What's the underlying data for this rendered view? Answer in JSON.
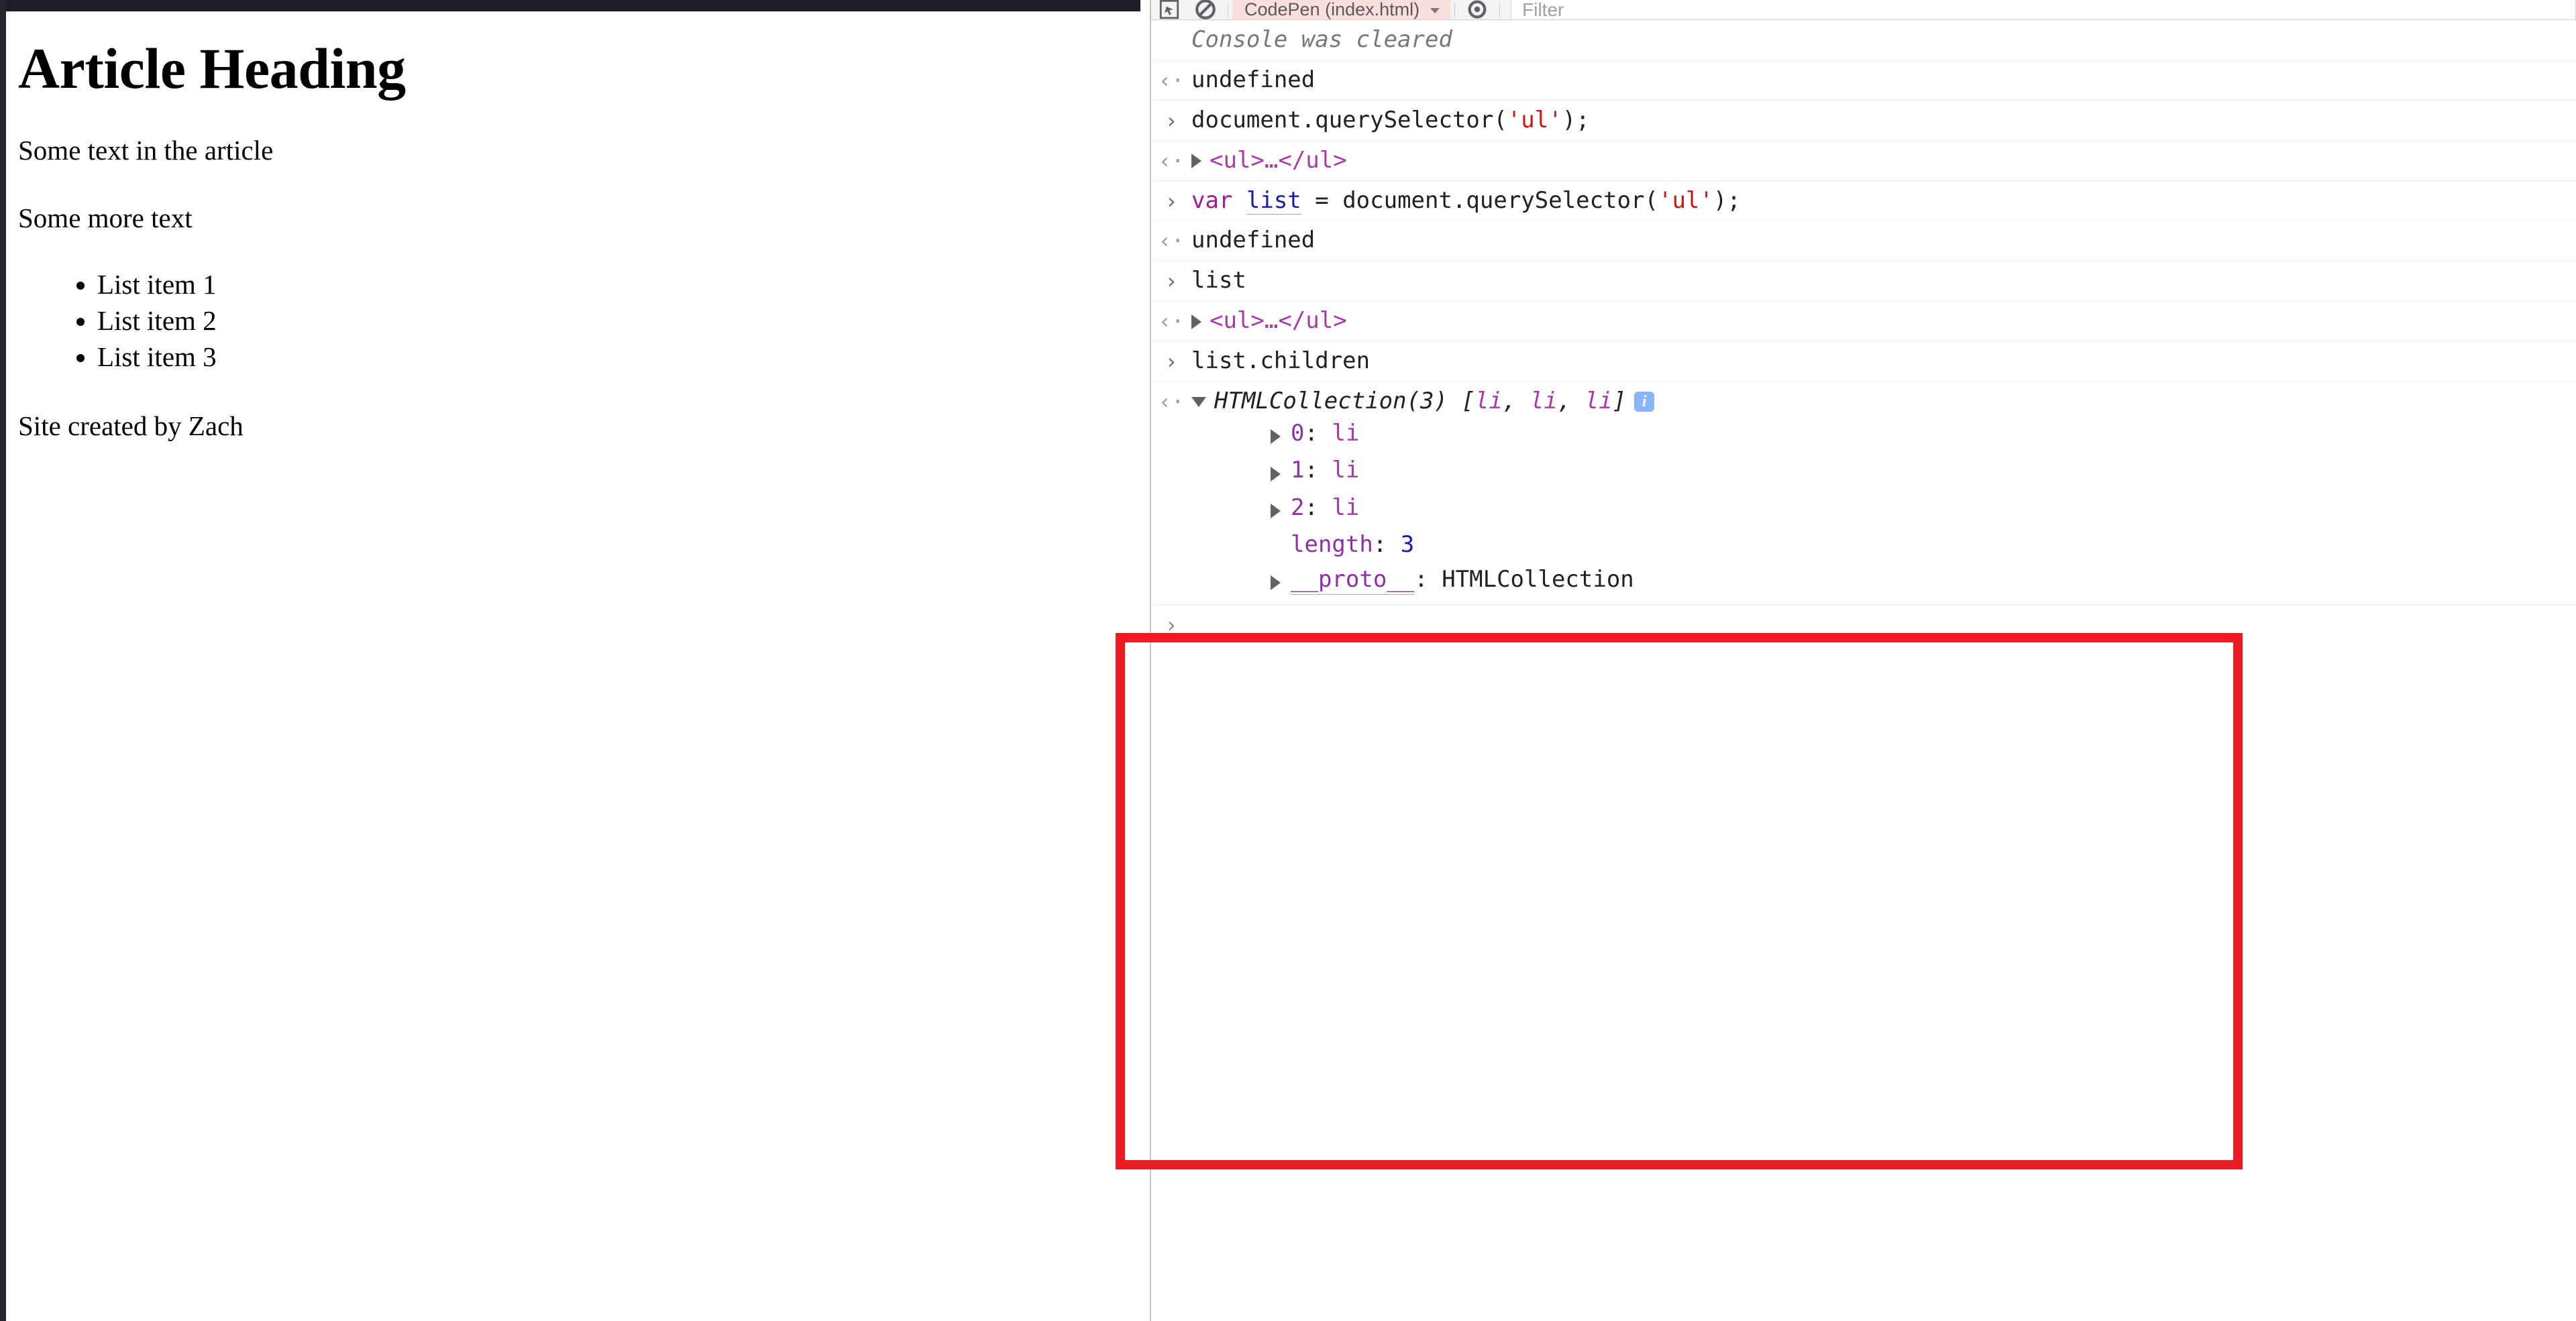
{
  "browser": {
    "chrome_bar_color": "#1d1d28"
  },
  "page": {
    "heading": "Article Heading",
    "paragraph_1": "Some text in the article",
    "paragraph_2": "Some more text",
    "list_items": [
      "List item 1",
      "List item 2",
      "List item 3"
    ],
    "footer": "Site created by Zach"
  },
  "devtools": {
    "toolbar": {
      "inspect_icon": "inspect-element-icon",
      "device_icon": "device-toolbar-icon",
      "clear_icon": "clear-console-icon",
      "context_label": "CodePen (index.html)",
      "context_caret": "chevron-down-icon",
      "filter_placeholder": "Filter"
    },
    "accent_colors": {
      "string": "#c41a16",
      "keyword": "#a21c8f",
      "variable": "#1a1aa6",
      "node": "#a63aa6",
      "property": "#8d31a6",
      "number": "#1a1aa6",
      "info_badge": "#8ab4f8",
      "annotation_box": "#ee1b22",
      "context_highlight": "#fbdede"
    },
    "messages": [
      {
        "kind": "system",
        "gutter": "",
        "text": "Console was cleared"
      },
      {
        "kind": "output",
        "gutter": "‹·",
        "text": "undefined"
      },
      {
        "kind": "input",
        "gutter": "›",
        "segments": [
          {
            "t": "document.querySelector(",
            "c": "plain"
          },
          {
            "t": "'ul'",
            "c": "str"
          },
          {
            "t": ");",
            "c": "plain"
          }
        ]
      },
      {
        "kind": "output",
        "gutter": "‹·",
        "triangle": "tri-right",
        "segments": [
          {
            "t": "<ul>…</ul>",
            "c": "node"
          }
        ]
      },
      {
        "kind": "input",
        "gutter": "›",
        "segments": [
          {
            "t": "var ",
            "c": "kw"
          },
          {
            "t": "list",
            "c": "var"
          },
          {
            "t": " = document.querySelector(",
            "c": "plain"
          },
          {
            "t": "'ul'",
            "c": "str"
          },
          {
            "t": ");",
            "c": "plain"
          }
        ]
      },
      {
        "kind": "output",
        "gutter": "‹·",
        "text": "undefined"
      },
      {
        "kind": "input",
        "gutter": "›",
        "segments": [
          {
            "t": "list",
            "c": "plain"
          }
        ]
      },
      {
        "kind": "output",
        "gutter": "‹·",
        "triangle": "tri-right",
        "segments": [
          {
            "t": "<ul>…</ul>",
            "c": "node"
          }
        ]
      },
      {
        "kind": "input",
        "gutter": "›",
        "segments": [
          {
            "t": "list.children",
            "c": "plain"
          }
        ]
      },
      {
        "kind": "output-expanded",
        "gutter": "‹·",
        "triangle": "tri-down",
        "segments": [
          {
            "t": "HTMLCollection(3) ",
            "c": "type"
          },
          {
            "t": "[",
            "c": "type"
          },
          {
            "t": "li",
            "c": "li"
          },
          {
            "t": ", ",
            "c": "type"
          },
          {
            "t": "li",
            "c": "li"
          },
          {
            "t": ", ",
            "c": "type"
          },
          {
            "t": "li",
            "c": "li"
          },
          {
            "t": "]",
            "c": "type"
          }
        ],
        "info_badge": "i",
        "children": [
          {
            "triangle": "tri-right",
            "key": "0",
            "sep": ": ",
            "value": "li",
            "key_class": "prop",
            "value_class": "node"
          },
          {
            "triangle": "tri-right",
            "key": "1",
            "sep": ": ",
            "value": "li",
            "key_class": "prop",
            "value_class": "node"
          },
          {
            "triangle": "tri-right",
            "key": "2",
            "sep": ": ",
            "value": "li",
            "key_class": "prop",
            "value_class": "node"
          },
          {
            "triangle": "",
            "key": "length",
            "sep": ": ",
            "value": "3",
            "key_class": "prop",
            "value_class": "num"
          },
          {
            "triangle": "tri-right",
            "key": "__proto__",
            "sep": ": ",
            "value": "HTMLCollection",
            "key_class": "proto",
            "value_class": "plain"
          }
        ]
      },
      {
        "kind": "prompt",
        "gutter": "›",
        "text": ""
      }
    ]
  }
}
